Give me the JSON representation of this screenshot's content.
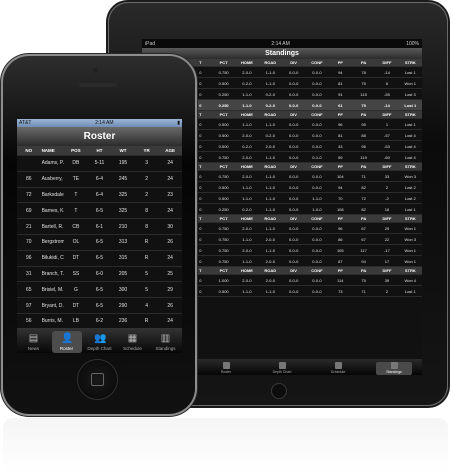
{
  "ipad": {
    "status": {
      "carrier": "iPad",
      "time": "2:14 AM",
      "battery": "100%"
    },
    "title": "Standings",
    "columns": [
      "W",
      "L",
      "T",
      "PCT",
      "HOME",
      "ROAD",
      "DIV",
      "CONF",
      "PF",
      "PA",
      "DIFF",
      "STRK"
    ],
    "rows": [
      {
        "type": "header",
        "cells": [
          "W",
          "L",
          "T",
          "PCT",
          "HOME",
          "ROAD",
          "DIV",
          "CONF",
          "PF",
          "PA",
          "DIFF",
          "STRK"
        ]
      },
      {
        "type": "row",
        "cells": [
          "1",
          "0",
          "0",
          "0.750",
          "2-0-0",
          "1-1-0",
          "0-0-0",
          "0-0-0",
          "94",
          "78",
          "-14",
          "Lost 1"
        ]
      },
      {
        "type": "row",
        "cells": [
          "1",
          "1",
          "0",
          "0.500",
          "0-2-0",
          "1-1-0",
          "0-0-0",
          "0-0-0",
          "81",
          "75",
          "6",
          "Won 1"
        ]
      },
      {
        "type": "row",
        "cells": [
          "1",
          "1",
          "0",
          "0.250",
          "1-1-0",
          "0-2-0",
          "0-0-0",
          "0-0-0",
          "91",
          "115",
          "-55",
          "Lost 3"
        ]
      },
      {
        "type": "hi",
        "cells": [
          "1",
          "0",
          "0",
          "0.250",
          "1-1-0",
          "0-2-0",
          "0-0-0",
          "0-0-0",
          "61",
          "75",
          "-14",
          "Lost 1"
        ]
      },
      {
        "type": "header",
        "cells": [
          "W",
          "L",
          "T",
          "PCT",
          "HOME",
          "ROAD",
          "DIV",
          "CONF",
          "PF",
          "PA",
          "DIFF",
          "STRK"
        ]
      },
      {
        "type": "row",
        "cells": [
          "1",
          "0",
          "0",
          "0.500",
          "1-1-0",
          "1-1-0",
          "0-0-0",
          "0-0-0",
          "96",
          "95",
          "1",
          "Lost 1"
        ]
      },
      {
        "type": "row",
        "cells": [
          "2",
          "0",
          "0",
          "0.500",
          "2-0-0",
          "0-2-0",
          "0-0-0",
          "0-0-0",
          "81",
          "88",
          "-57",
          "Lost 4"
        ]
      },
      {
        "type": "row",
        "cells": [
          "4",
          "0",
          "0",
          "0.500",
          "0-2-0",
          "2-0-0",
          "0-0-0",
          "0-0-0",
          "43",
          "96",
          "-53",
          "Lost 4"
        ]
      },
      {
        "type": "row",
        "cells": [
          "3",
          "0",
          "0",
          "0.750",
          "2-0-0",
          "1-1-0",
          "0-0-0",
          "0-1-0",
          "59",
          "119",
          "-60",
          "Lost 4"
        ]
      },
      {
        "type": "header",
        "cells": [
          "W",
          "L",
          "T",
          "PCT",
          "HOME",
          "ROAD",
          "DIV",
          "CONF",
          "PF",
          "PA",
          "DIFF",
          "STRK"
        ]
      },
      {
        "type": "row",
        "cells": [
          "1",
          "0",
          "0",
          "0.750",
          "2-0-0",
          "1-1-0",
          "0-0-0",
          "0-0-0",
          "104",
          "71",
          "33",
          "Won 3"
        ]
      },
      {
        "type": "row",
        "cells": [
          "1",
          "1",
          "0",
          "0.500",
          "1-1-0",
          "1-1-0",
          "0-0-0",
          "0-0-0",
          "94",
          "82",
          "2",
          "Lost 2"
        ]
      },
      {
        "type": "row",
        "cells": [
          "1",
          "2",
          "0",
          "0.500",
          "1-1-0",
          "1-1-0",
          "0-0-0",
          "1-1-0",
          "70",
          "72",
          "-2",
          "Lost 2"
        ]
      },
      {
        "type": "row",
        "cells": [
          "1",
          "0",
          "0",
          "0.250",
          "0-2-0",
          "1-1-0",
          "0-0-0",
          "1-0-0",
          "108",
          "82",
          "16",
          "Lost 1"
        ]
      },
      {
        "type": "header",
        "cells": [
          "W",
          "L",
          "T",
          "PCT",
          "HOME",
          "ROAD",
          "DIV",
          "CONF",
          "PF",
          "PA",
          "DIFF",
          "STRK"
        ]
      },
      {
        "type": "row",
        "cells": [
          "1",
          "0",
          "0",
          "0.750",
          "2-0-0",
          "1-1-0",
          "0-0-0",
          "0-0-0",
          "96",
          "67",
          "29",
          "Won 1"
        ]
      },
      {
        "type": "row",
        "cells": [
          "1",
          "0",
          "0",
          "0.750",
          "1-1-0",
          "2-0-0",
          "0-0-0",
          "0-0-0",
          "86",
          "67",
          "22",
          "Won 3"
        ]
      },
      {
        "type": "row",
        "cells": [
          "3",
          "0",
          "0",
          "0.750",
          "2-0-0",
          "1-1-0",
          "0-0-0",
          "0-0-0",
          "105",
          "117",
          "-17",
          "Won 1"
        ]
      },
      {
        "type": "row",
        "cells": [
          "2",
          "0",
          "0",
          "0.750",
          "1-1-0",
          "2-0-0",
          "0-0-0",
          "0-0-0",
          "87",
          "94",
          "17",
          "Won 1"
        ]
      },
      {
        "type": "header",
        "cells": [
          "W",
          "L",
          "T",
          "PCT",
          "HOME",
          "ROAD",
          "DIV",
          "CONF",
          "PF",
          "PA",
          "DIFF",
          "STRK"
        ]
      },
      {
        "type": "row",
        "cells": [
          "1",
          "1",
          "0",
          "1.000",
          "2-0-0",
          "2-0-0",
          "0-0-0",
          "0-0-0",
          "114",
          "75",
          "39",
          "Won 4"
        ]
      },
      {
        "type": "row",
        "cells": [
          "1",
          "0",
          "0",
          "0.500",
          "1-1-0",
          "1-1-0",
          "0-0-0",
          "0-0-0",
          "73",
          "71",
          "2",
          "Lost 1"
        ]
      }
    ],
    "tabs": [
      {
        "label": "News",
        "icon": "newspaper-icon"
      },
      {
        "label": "Roster",
        "icon": "person-icon"
      },
      {
        "label": "Depth Chart",
        "icon": "group-icon"
      },
      {
        "label": "Schedule",
        "icon": "calendar-icon"
      },
      {
        "label": "Standings",
        "icon": "standings-icon",
        "active": true
      }
    ]
  },
  "iphone": {
    "status": {
      "carrier": "AT&T",
      "time": "2:14 AM"
    },
    "title": "Roster",
    "header": [
      "NO",
      "NAME",
      "POS",
      "HT",
      "WT",
      "YR",
      "AGE"
    ],
    "rows": [
      [
        "",
        "Adams, P.",
        "DB",
        "5-11",
        "195",
        "3",
        "24"
      ],
      [
        "86",
        "Ausberry, D.",
        "TE",
        "6-4",
        "245",
        "2",
        "24"
      ],
      [
        "72",
        "Barksdale, J.",
        "T",
        "6-4",
        "325",
        "2",
        "23"
      ],
      [
        "69",
        "Barnes, K.",
        "T",
        "6-5",
        "325",
        "8",
        "24"
      ],
      [
        "21",
        "Bartell, R.",
        "CB",
        "6-1",
        "210",
        "8",
        "30"
      ],
      [
        "70",
        "Bergstrom, T.",
        "OL",
        "6-5",
        "313",
        "R",
        "26"
      ],
      [
        "96",
        "Bilukidi, C.",
        "DT",
        "6-5",
        "315",
        "R",
        "24"
      ],
      [
        "31",
        "Branch, T.",
        "SS",
        "6-0",
        "205",
        "5",
        "25"
      ],
      [
        "65",
        "Brisiel, M.",
        "G",
        "6-5",
        "300",
        "5",
        "29"
      ],
      [
        "97",
        "Bryant, D.",
        "DT",
        "6-5",
        "290",
        "4",
        "26"
      ],
      [
        "56",
        "Burris, M.",
        "LB",
        "6-2",
        "236",
        "R",
        "24"
      ],
      [
        "66",
        "Carlisle, C.",
        "G",
        "6-5",
        "295",
        "13",
        "35"
      ]
    ],
    "tabs": [
      {
        "label": "News",
        "icon": "newspaper-icon"
      },
      {
        "label": "Roster",
        "icon": "person-icon",
        "active": true
      },
      {
        "label": "Depth Chart",
        "icon": "group-icon"
      },
      {
        "label": "Schedule",
        "icon": "calendar-icon"
      },
      {
        "label": "Standings",
        "icon": "standings-icon"
      }
    ]
  }
}
